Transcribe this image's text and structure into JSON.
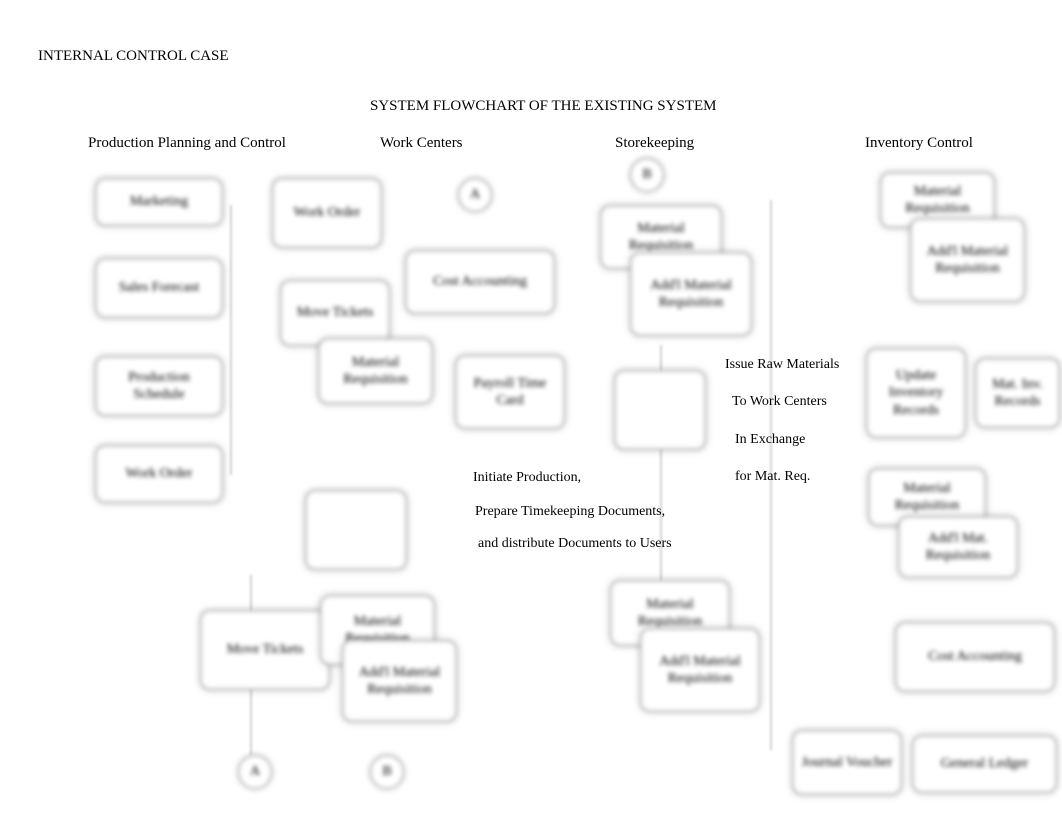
{
  "header": {
    "case_title": "INTERNAL CONTROL CASE",
    "flow_title": "SYSTEM FLOWCHART OF THE EXISTING SYSTEM"
  },
  "columns": {
    "ppc": "Production Planning and Control",
    "wc": "Work Centers",
    "sk": "Storekeeping",
    "ic": "Inventory Control"
  },
  "connectors": {
    "a_top": "A",
    "b_top": "B",
    "a_bottom": "A",
    "b_bottom": "B"
  },
  "ppc": {
    "marketing": "Marketing",
    "sales_forecast": "Sales Forecast",
    "prod_schedule": "Production Schedule",
    "work_order_left": "Work Order",
    "work_order_right": "Work Order",
    "move_tickets_top": "Move Tickets",
    "material_req_top": "Material Requisition",
    "move_tickets_bottom": "Move Tickets",
    "material_req_bottom": "Material Requisition",
    "addl_material_req_bottom": "Add'l Material Requisition"
  },
  "wc": {
    "cost_accounting": "Cost Accounting",
    "payroll_timecard": "Payroll Time Card",
    "narrative_l1": "Initiate Production,",
    "narrative_l2": "Prepare Timekeeping Documents,",
    "narrative_l3": "and distribute Documents to Users"
  },
  "sk": {
    "material_req_top": "Material Requisition",
    "addl_material_req_top": "Add'l Material Requisition",
    "issue_l1": "Issue Raw Materials",
    "issue_l2": "To Work Centers",
    "issue_l3": "In Exchange",
    "issue_l4": "for Mat. Req.",
    "material_req_bottom": "Material Requisition",
    "addl_material_req_bottom": "Add'l Material Requisition"
  },
  "ic": {
    "material_req_top": "Material Requisition",
    "addl_material_req_top": "Add'l Material Requisition",
    "update_inv": "Update Inventory Records",
    "mat_inv_records": "Mat. Inv. Records",
    "material_req_mid": "Material Requisition",
    "addl_mat_req_mid": "Add'l Mat. Requisition",
    "cost_accounting": "Cost Accounting",
    "journal_voucher": "Journal Voucher",
    "general_ledger": "General Ledger"
  }
}
